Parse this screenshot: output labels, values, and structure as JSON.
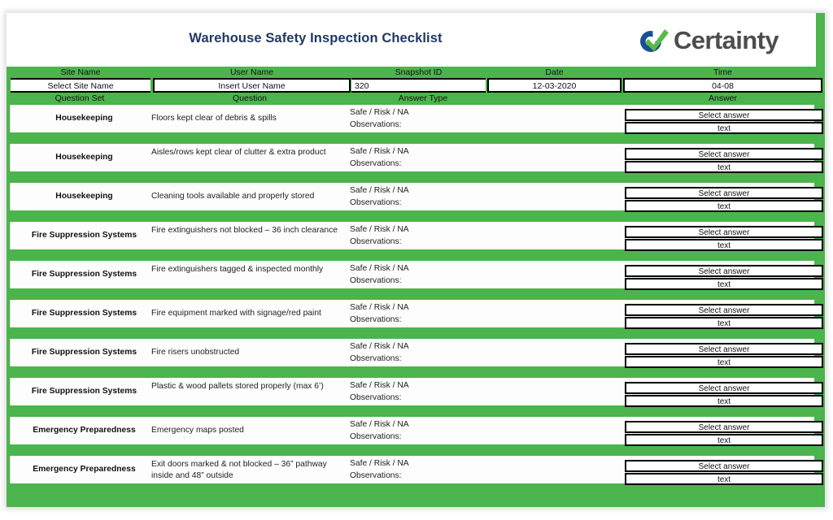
{
  "header": {
    "title": "Warehouse Safety Inspection Checklist",
    "logo_mark": "certainty-check-logo",
    "logo_text": "Certainty",
    "brand_blue": "#17508f",
    "brand_green": "#5cb947",
    "title_color": "#1f3864",
    "sheet_green": "#4cb44c"
  },
  "info": {
    "columns": [
      "Site Name",
      "User Name",
      "Snapshot ID",
      "Date",
      "Time"
    ],
    "values": {
      "site_name": "Select Site Name",
      "user_name": "Insert User Name",
      "snapshot_id": "320",
      "date": "12-03-2020",
      "time": "04-08"
    }
  },
  "table": {
    "columns": [
      "Question Set",
      "Question",
      "Answer Type",
      "Answer"
    ],
    "answer_type_line1": "Safe / Risk / NA",
    "answer_type_line2": "Observations:",
    "answer_select_label": "Select answer",
    "answer_text_label": "text",
    "rows": [
      {
        "question_set": "Housekeeping",
        "question": "Floors kept clear of debris & spills",
        "answer_type_1": "Safe / Risk / NA",
        "answer_type_2": "Observations:",
        "answer_select": "Select answer",
        "answer_text": "text"
      },
      {
        "question_set": "Housekeeping",
        "question": "Aisles/rows kept clear of clutter & extra product",
        "answer_type_1": "Safe / Risk / NA",
        "answer_type_2": "Observations:",
        "answer_select": "Select answer",
        "answer_text": "text"
      },
      {
        "question_set": "Housekeeping",
        "question": "Cleaning tools available and properly stored",
        "answer_type_1": "Safe / Risk / NA",
        "answer_type_2": "Observations:",
        "answer_select": "Select answer",
        "answer_text": "text"
      },
      {
        "question_set": "Fire Suppression Systems",
        "question": "Fire extinguishers not blocked – 36 inch clearance",
        "answer_type_1": "Safe / Risk / NA",
        "answer_type_2": "Observations:",
        "answer_select": "Select answer",
        "answer_text": "text"
      },
      {
        "question_set": "Fire Suppression Systems",
        "question": "Fire extinguishers tagged & inspected  monthly",
        "answer_type_1": "Safe / Risk / NA",
        "answer_type_2": "Observations:",
        "answer_select": "Select answer",
        "answer_text": "text"
      },
      {
        "question_set": "Fire Suppression Systems",
        "question": "Fire equipment marked with signage/red paint",
        "answer_type_1": "Safe / Risk / NA",
        "answer_type_2": "Observations:",
        "answer_select": "Select answer",
        "answer_text": "text"
      },
      {
        "question_set": "Fire Suppression Systems",
        "question": "Fire risers unobstructed",
        "answer_type_1": "Safe / Risk / NA",
        "answer_type_2": "Observations:",
        "answer_select": "Select answer",
        "answer_text": "text"
      },
      {
        "question_set": "Fire Suppression Systems",
        "question": "Plastic & wood pallets stored properly (max 6’)",
        "answer_type_1": "Safe / Risk / NA",
        "answer_type_2": "Observations:",
        "answer_select": "Select answer",
        "answer_text": "text"
      },
      {
        "question_set": "Emergency Preparedness",
        "question": "Emergency maps posted",
        "answer_type_1": "Safe / Risk / NA",
        "answer_type_2": "Observations:",
        "answer_select": "Select answer",
        "answer_text": "text"
      },
      {
        "question_set": "Emergency Preparedness",
        "question": "Exit doors marked & not blocked – 36” pathway inside and 48” outside",
        "answer_type_1": "Safe / Risk / NA",
        "answer_type_2": "Observations:",
        "answer_select": "Select answer",
        "answer_text": "text"
      }
    ]
  }
}
